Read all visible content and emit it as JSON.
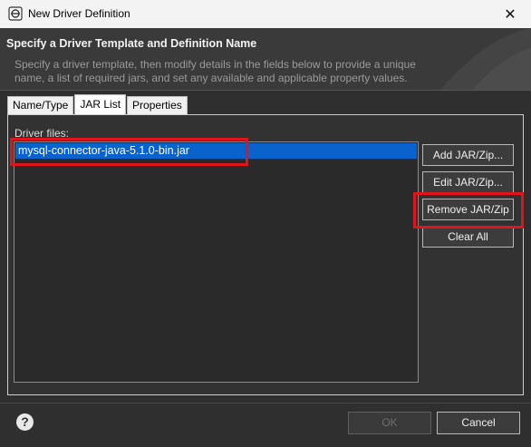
{
  "window": {
    "title": "New Driver Definition",
    "close_glyph": "✕"
  },
  "header": {
    "title": "Specify a Driver Template and Definition Name",
    "description": "Specify a driver template, then modify details in the fields below to provide a unique name, a list of required jars, and set any available and applicable property values."
  },
  "tabs": [
    {
      "label": "Name/Type",
      "active": false
    },
    {
      "label": "JAR List",
      "active": true
    },
    {
      "label": "Properties",
      "active": false
    }
  ],
  "jar_list": {
    "label": "Driver files:",
    "files": [
      "mysql-connector-java-5.1.0-bin.jar"
    ],
    "selected_index": 0
  },
  "buttons": {
    "add_jar": "Add JAR/Zip...",
    "edit_jar": "Edit JAR/Zip...",
    "remove_jar": "Remove JAR/Zip",
    "clear_all": "Clear All",
    "ok": "OK",
    "cancel": "Cancel"
  },
  "colors": {
    "selection": "#0a62cc",
    "highlight_annotation": "#e3131b",
    "background": "#2f2f2f"
  },
  "icons": {
    "app": "eclipse-icon",
    "help": "help-icon",
    "close": "close-icon"
  }
}
